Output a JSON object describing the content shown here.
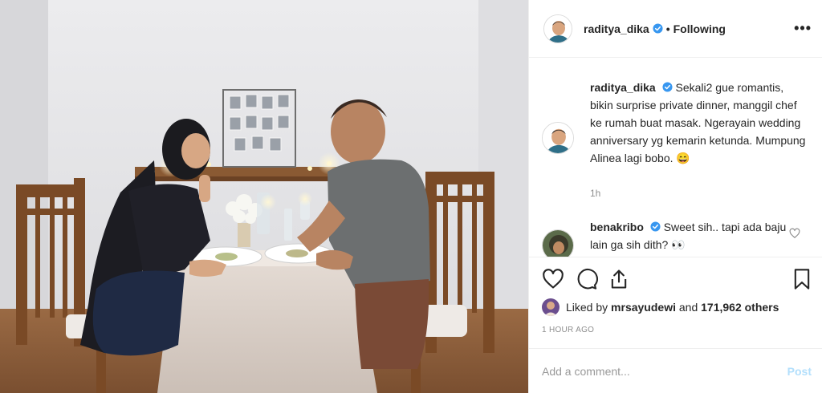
{
  "header": {
    "username": "raditya_dika",
    "separator": "•",
    "follow_label": "Following",
    "more_label": "•••"
  },
  "caption": {
    "username": "raditya_dika",
    "text": "Sekali2 gue romantis, bikin surprise private dinner, manggil chef ke rumah buat masak. Ngerayain wedding anniversary yg kemarin ketunda. Mumpung Alinea lagi bobo.",
    "emoji": "😄",
    "time": "1h"
  },
  "comment": {
    "username": "benakribo",
    "text": "Sweet sih.. tapi ada baju lain ga sih dith? 👀"
  },
  "likes": {
    "prefix": "Liked by",
    "user": "mrsayudewi",
    "middle": "and",
    "count": "171,962 others"
  },
  "timestamp": "1 HOUR AGO",
  "add_comment": {
    "placeholder": "Add a comment...",
    "post_label": "Post"
  },
  "icons": {
    "like": "heart-icon",
    "comment": "comment-icon",
    "share": "share-icon",
    "save": "bookmark-icon",
    "more": "more-icon",
    "verified": "verified-badge-icon"
  },
  "colors": {
    "verified": "#3897f0",
    "post_disabled": "#b2dffc",
    "muted": "#8e8e8e"
  }
}
